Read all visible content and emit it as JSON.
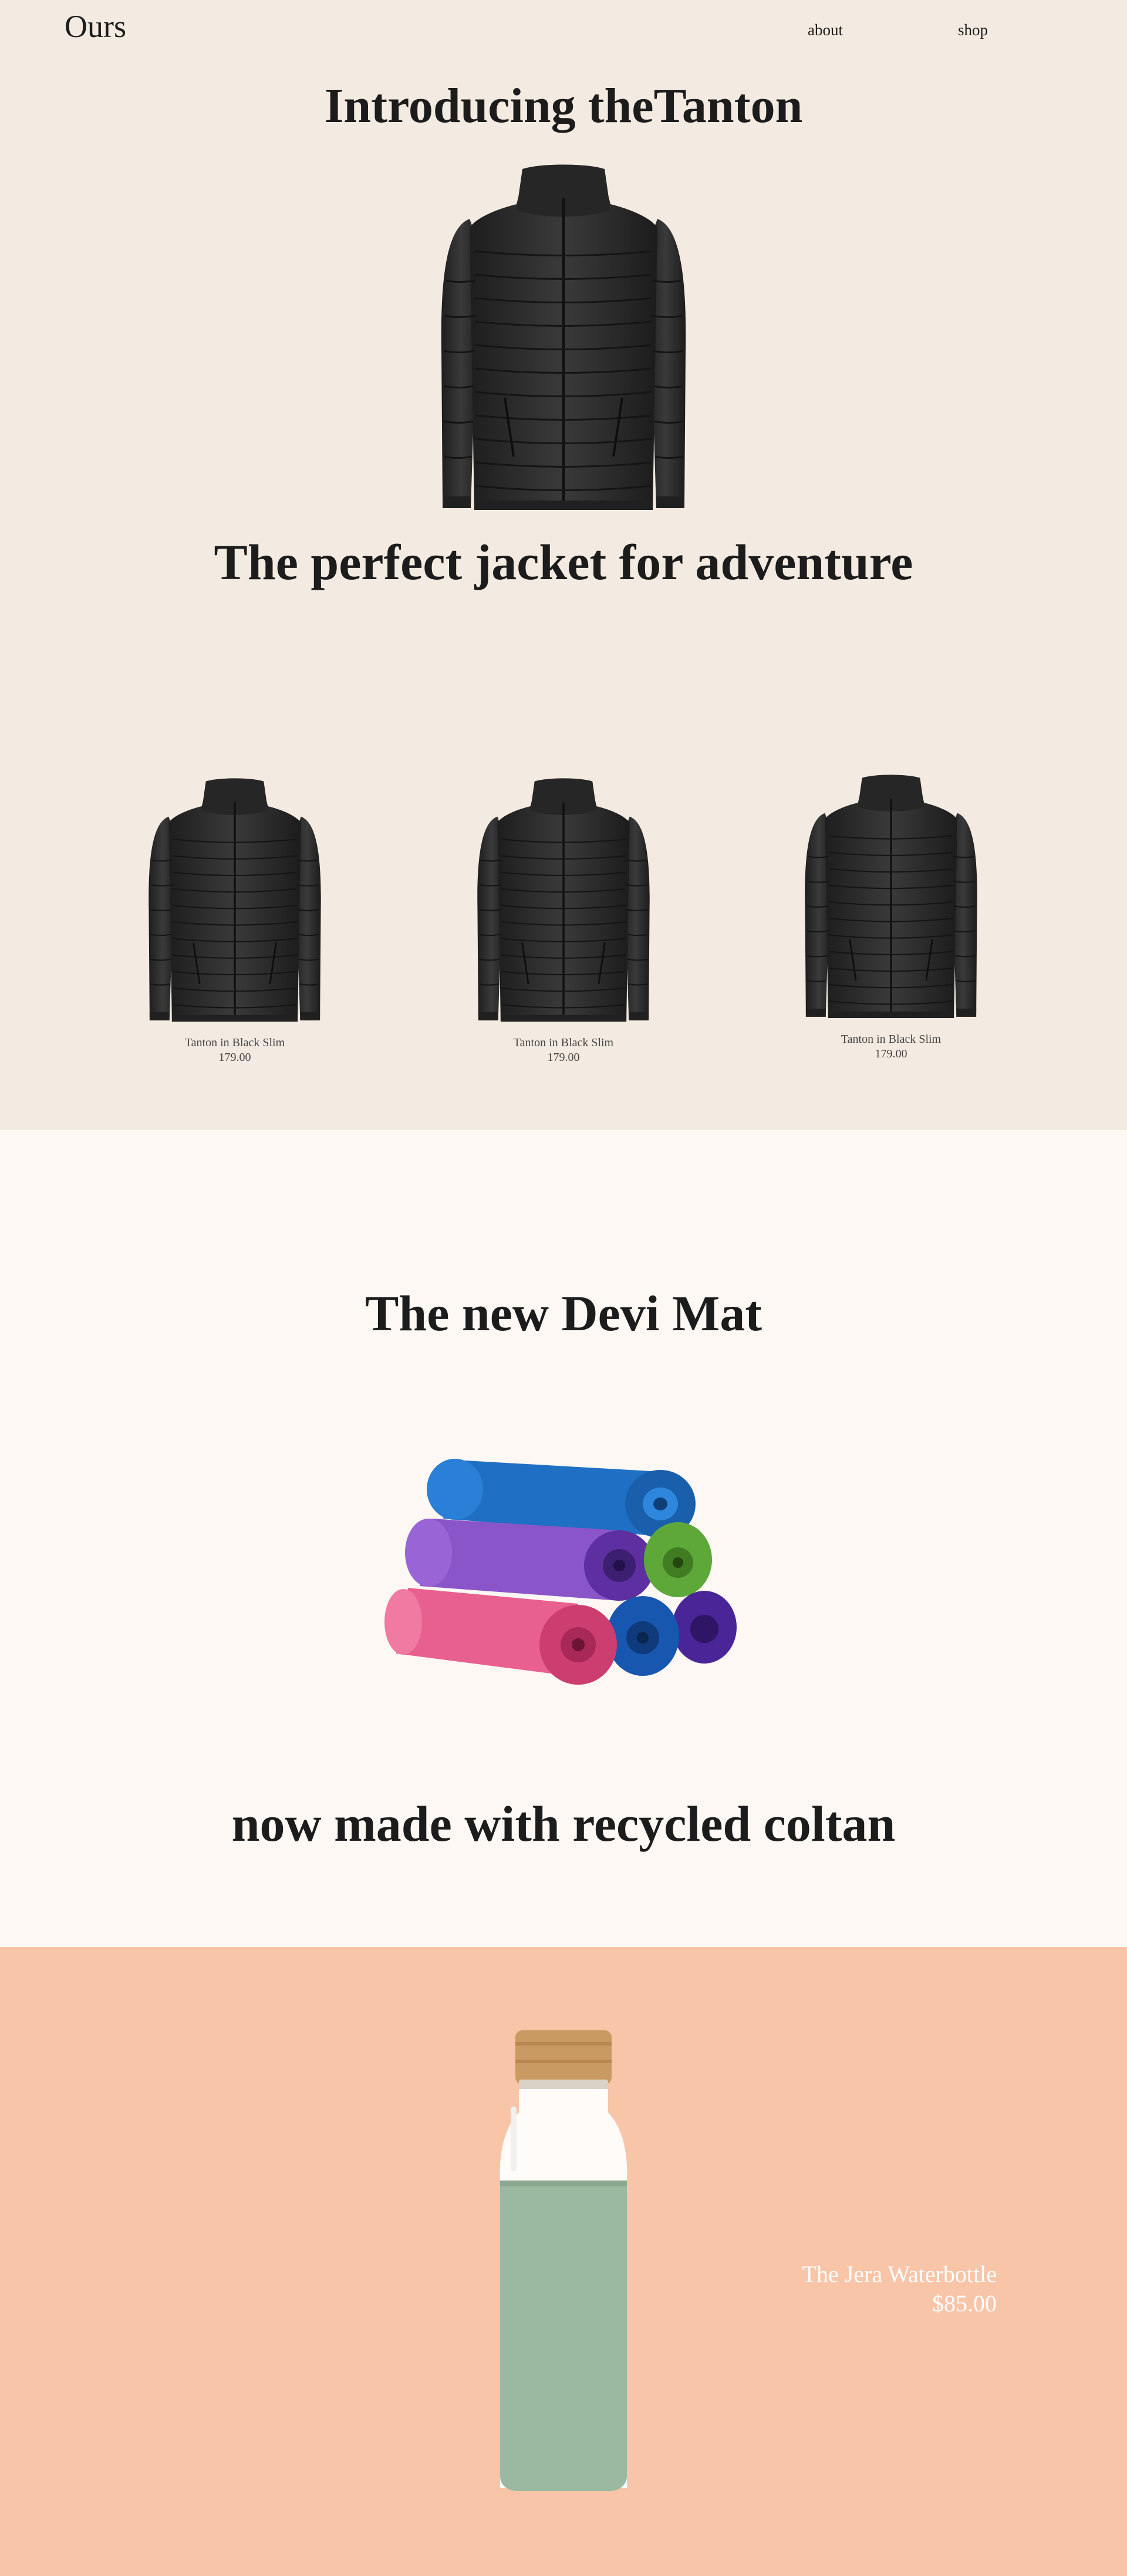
{
  "nav": {
    "logo": "Ours",
    "links": [
      {
        "label": "about"
      },
      {
        "label": "shop"
      }
    ]
  },
  "hero": {
    "title": "Introducing theTanton",
    "tagline": "The perfect jacket for adventure",
    "image_icon": "black-puffer-jacket"
  },
  "products": [
    {
      "name": "Tanton in Black Slim",
      "price": "179.00",
      "image_icon": "black-puffer-jacket"
    },
    {
      "name": "Tanton in Black Slim",
      "price": "179.00",
      "image_icon": "black-puffer-jacket"
    },
    {
      "name": "Tanton in Black Slim",
      "price": "179.00",
      "image_icon": "black-puffer-jacket"
    }
  ],
  "mat_section": {
    "title": "The new Devi Mat",
    "subtitle": "now made with recycled coltan",
    "image_icon": "yoga-mats-stack"
  },
  "bottle_section": {
    "name": "The Jera Waterbottle",
    "price": "$85.00",
    "image_icon": "glass-water-bottle"
  },
  "colors": {
    "section1_bg": "#f3ebe1",
    "section2_bg": "#fdf8f4",
    "section3_bg": "#f8c5a8",
    "text": "#1c1c1c"
  }
}
